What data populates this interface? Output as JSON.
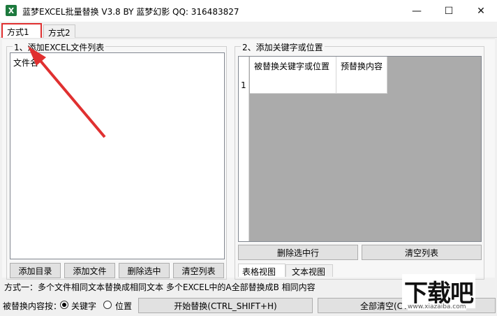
{
  "window": {
    "title": "蓝梦EXCEL批量替换 V3.8 BY 蓝梦幻影 QQ: 316483827",
    "minimize": "—",
    "maximize": "☐",
    "close": "✕"
  },
  "tabs": [
    {
      "label": "方式1"
    },
    {
      "label": "方式2"
    }
  ],
  "left_group": {
    "label": "1、添加EXCEL文件列表",
    "column_header": "文件名",
    "buttons": {
      "add_dir": "添加目录",
      "add_file": "添加文件",
      "delete_selected": "删除选中",
      "clear_list": "清空列表"
    }
  },
  "right_group": {
    "label": "2、添加关键字或位置",
    "columns": {
      "find": "被替换关键字或位置",
      "replace": "预替换内容"
    },
    "row_number": "1",
    "buttons": {
      "delete_row": "删除选中行",
      "clear_list": "清空列表"
    },
    "view_tabs": {
      "table": "表格视图",
      "text": "文本视图"
    }
  },
  "status": {
    "text": "方式一：多个文件相同文本替换成相同文本  多个EXCEL中的A全部替换成B 相同内容"
  },
  "bottom": {
    "replace_by_label": "被替换内容按：",
    "opt_keyword": "关键字",
    "opt_position": "位置",
    "start_button": "开始替换(CTRL_SHIFT+H)",
    "clear_all_button": "全部清空(CT"
  },
  "watermark": {
    "text": "下载吧",
    "url": "www.xiazaiba.com"
  },
  "colors": {
    "highlight": "#e03030",
    "titlebar": "#ffffff",
    "window": "#f0f0f0"
  }
}
